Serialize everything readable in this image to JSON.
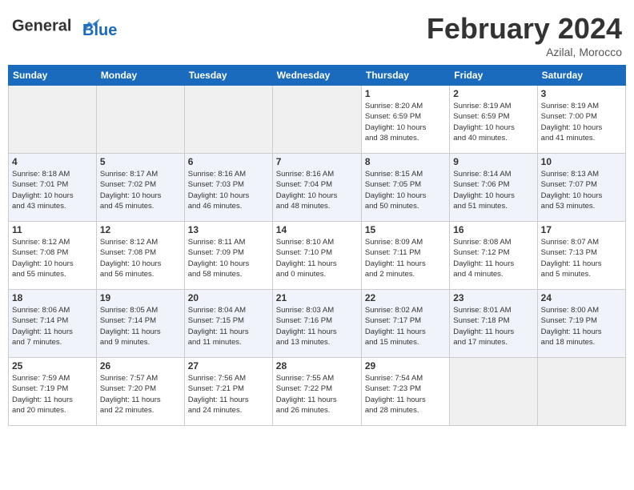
{
  "header": {
    "logo_line1": "General",
    "logo_line2": "Blue",
    "month": "February 2024",
    "location": "Azilal, Morocco"
  },
  "days_of_week": [
    "Sunday",
    "Monday",
    "Tuesday",
    "Wednesday",
    "Thursday",
    "Friday",
    "Saturday"
  ],
  "weeks": [
    [
      {
        "day": "",
        "info": ""
      },
      {
        "day": "",
        "info": ""
      },
      {
        "day": "",
        "info": ""
      },
      {
        "day": "",
        "info": ""
      },
      {
        "day": "1",
        "info": "Sunrise: 8:20 AM\nSunset: 6:59 PM\nDaylight: 10 hours\nand 38 minutes."
      },
      {
        "day": "2",
        "info": "Sunrise: 8:19 AM\nSunset: 6:59 PM\nDaylight: 10 hours\nand 40 minutes."
      },
      {
        "day": "3",
        "info": "Sunrise: 8:19 AM\nSunset: 7:00 PM\nDaylight: 10 hours\nand 41 minutes."
      }
    ],
    [
      {
        "day": "4",
        "info": "Sunrise: 8:18 AM\nSunset: 7:01 PM\nDaylight: 10 hours\nand 43 minutes."
      },
      {
        "day": "5",
        "info": "Sunrise: 8:17 AM\nSunset: 7:02 PM\nDaylight: 10 hours\nand 45 minutes."
      },
      {
        "day": "6",
        "info": "Sunrise: 8:16 AM\nSunset: 7:03 PM\nDaylight: 10 hours\nand 46 minutes."
      },
      {
        "day": "7",
        "info": "Sunrise: 8:16 AM\nSunset: 7:04 PM\nDaylight: 10 hours\nand 48 minutes."
      },
      {
        "day": "8",
        "info": "Sunrise: 8:15 AM\nSunset: 7:05 PM\nDaylight: 10 hours\nand 50 minutes."
      },
      {
        "day": "9",
        "info": "Sunrise: 8:14 AM\nSunset: 7:06 PM\nDaylight: 10 hours\nand 51 minutes."
      },
      {
        "day": "10",
        "info": "Sunrise: 8:13 AM\nSunset: 7:07 PM\nDaylight: 10 hours\nand 53 minutes."
      }
    ],
    [
      {
        "day": "11",
        "info": "Sunrise: 8:12 AM\nSunset: 7:08 PM\nDaylight: 10 hours\nand 55 minutes."
      },
      {
        "day": "12",
        "info": "Sunrise: 8:12 AM\nSunset: 7:08 PM\nDaylight: 10 hours\nand 56 minutes."
      },
      {
        "day": "13",
        "info": "Sunrise: 8:11 AM\nSunset: 7:09 PM\nDaylight: 10 hours\nand 58 minutes."
      },
      {
        "day": "14",
        "info": "Sunrise: 8:10 AM\nSunset: 7:10 PM\nDaylight: 11 hours\nand 0 minutes."
      },
      {
        "day": "15",
        "info": "Sunrise: 8:09 AM\nSunset: 7:11 PM\nDaylight: 11 hours\nand 2 minutes."
      },
      {
        "day": "16",
        "info": "Sunrise: 8:08 AM\nSunset: 7:12 PM\nDaylight: 11 hours\nand 4 minutes."
      },
      {
        "day": "17",
        "info": "Sunrise: 8:07 AM\nSunset: 7:13 PM\nDaylight: 11 hours\nand 5 minutes."
      }
    ],
    [
      {
        "day": "18",
        "info": "Sunrise: 8:06 AM\nSunset: 7:14 PM\nDaylight: 11 hours\nand 7 minutes."
      },
      {
        "day": "19",
        "info": "Sunrise: 8:05 AM\nSunset: 7:14 PM\nDaylight: 11 hours\nand 9 minutes."
      },
      {
        "day": "20",
        "info": "Sunrise: 8:04 AM\nSunset: 7:15 PM\nDaylight: 11 hours\nand 11 minutes."
      },
      {
        "day": "21",
        "info": "Sunrise: 8:03 AM\nSunset: 7:16 PM\nDaylight: 11 hours\nand 13 minutes."
      },
      {
        "day": "22",
        "info": "Sunrise: 8:02 AM\nSunset: 7:17 PM\nDaylight: 11 hours\nand 15 minutes."
      },
      {
        "day": "23",
        "info": "Sunrise: 8:01 AM\nSunset: 7:18 PM\nDaylight: 11 hours\nand 17 minutes."
      },
      {
        "day": "24",
        "info": "Sunrise: 8:00 AM\nSunset: 7:19 PM\nDaylight: 11 hours\nand 18 minutes."
      }
    ],
    [
      {
        "day": "25",
        "info": "Sunrise: 7:59 AM\nSunset: 7:19 PM\nDaylight: 11 hours\nand 20 minutes."
      },
      {
        "day": "26",
        "info": "Sunrise: 7:57 AM\nSunset: 7:20 PM\nDaylight: 11 hours\nand 22 minutes."
      },
      {
        "day": "27",
        "info": "Sunrise: 7:56 AM\nSunset: 7:21 PM\nDaylight: 11 hours\nand 24 minutes."
      },
      {
        "day": "28",
        "info": "Sunrise: 7:55 AM\nSunset: 7:22 PM\nDaylight: 11 hours\nand 26 minutes."
      },
      {
        "day": "29",
        "info": "Sunrise: 7:54 AM\nSunset: 7:23 PM\nDaylight: 11 hours\nand 28 minutes."
      },
      {
        "day": "",
        "info": ""
      },
      {
        "day": "",
        "info": ""
      }
    ]
  ]
}
